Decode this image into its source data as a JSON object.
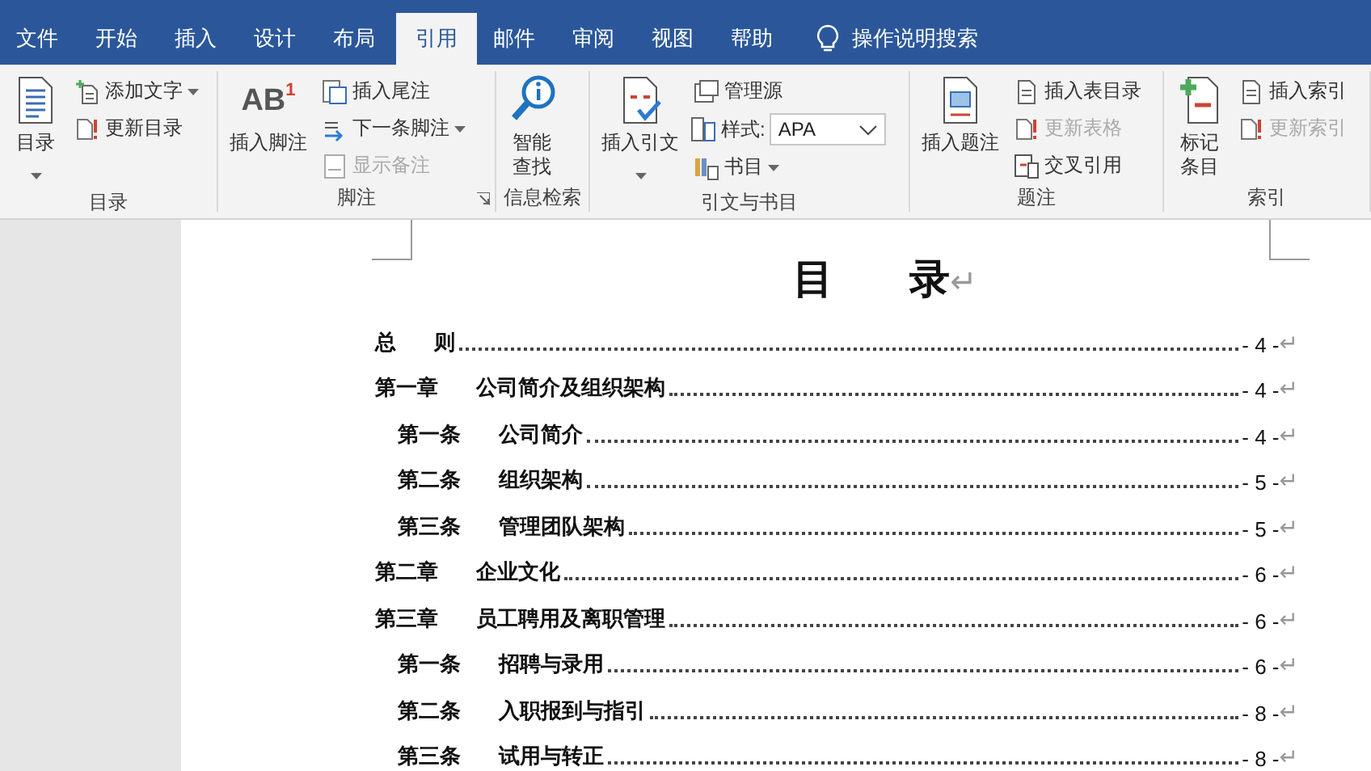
{
  "tabs": [
    {
      "label": "文件",
      "selected": false
    },
    {
      "label": "开始",
      "selected": false
    },
    {
      "label": "插入",
      "selected": false
    },
    {
      "label": "设计",
      "selected": false
    },
    {
      "label": "布局",
      "selected": false
    },
    {
      "label": "引用",
      "selected": true
    },
    {
      "label": "邮件",
      "selected": false
    },
    {
      "label": "审阅",
      "selected": false
    },
    {
      "label": "视图",
      "selected": false
    },
    {
      "label": "帮助",
      "selected": false
    }
  ],
  "tell_me": {
    "placeholder": "操作说明搜索"
  },
  "ribbon_groups": [
    {
      "label": "目录",
      "launcher": false,
      "big": [
        {
          "label": "目录",
          "dropdown": true
        }
      ],
      "small": [
        {
          "kind": "button",
          "label": "添加文字",
          "dropdown": true,
          "disabled": false
        },
        {
          "kind": "button",
          "label": "更新目录",
          "dropdown": false,
          "disabled": false
        }
      ]
    },
    {
      "label": "脚注",
      "launcher": true,
      "big": [
        {
          "label": "插入脚注",
          "glyph": "AB",
          "glyph_sup": "1",
          "dropdown": false
        }
      ],
      "small": [
        {
          "kind": "button",
          "label": "插入尾注",
          "dropdown": false,
          "disabled": false
        },
        {
          "kind": "button",
          "label": "下一条脚注",
          "dropdown": true,
          "disabled": false
        },
        {
          "kind": "button",
          "label": "显示备注",
          "dropdown": false,
          "disabled": true
        }
      ]
    },
    {
      "label": "信息检索",
      "launcher": false,
      "big": [
        {
          "label": "智能查找",
          "dropdown": false
        }
      ]
    },
    {
      "label": "引文与书目",
      "launcher": false,
      "big": [
        {
          "label": "插入引文",
          "dropdown": true
        }
      ],
      "small": [
        {
          "kind": "button",
          "label": "管理源",
          "dropdown": false,
          "disabled": false
        },
        {
          "kind": "select",
          "label": "样式:",
          "value": "APA"
        },
        {
          "kind": "button",
          "label": "书目",
          "dropdown": true,
          "disabled": false
        }
      ]
    },
    {
      "label": "题注",
      "launcher": false,
      "big": [
        {
          "label": "插入题注",
          "dropdown": false
        }
      ],
      "small": [
        {
          "kind": "button",
          "label": "插入表目录",
          "dropdown": false,
          "disabled": false
        },
        {
          "kind": "button",
          "label": "更新表格",
          "dropdown": false,
          "disabled": true
        },
        {
          "kind": "button",
          "label": "交叉引用",
          "dropdown": false,
          "disabled": false
        }
      ]
    },
    {
      "label": "索引",
      "launcher": false,
      "big": [
        {
          "label": "标记条目",
          "dropdown": false
        }
      ],
      "small": [
        {
          "kind": "button",
          "label": "插入索引",
          "dropdown": false,
          "disabled": false
        },
        {
          "kind": "button",
          "label": "更新索引",
          "dropdown": false,
          "disabled": true
        }
      ]
    }
  ],
  "document": {
    "title": "目 录",
    "title_mark": "↵",
    "toc": [
      {
        "title": "总 则",
        "page": "- 4 -",
        "end_mark": "↵"
      },
      {
        "number": "第一章",
        "title": "公司简介及组织架构",
        "page": "- 4 -",
        "end_mark": "↵",
        "children": [
          {
            "number": "第一条",
            "title": "公司简介",
            "page": "- 4 -",
            "end_mark": "↵"
          },
          {
            "number": "第二条",
            "title": "组织架构",
            "page": "- 5 -",
            "end_mark": "↵"
          },
          {
            "number": "第三条",
            "title": "管理团队架构",
            "page": "- 5 -",
            "end_mark": "↵"
          }
        ]
      },
      {
        "number": "第二章",
        "title": "企业文化",
        "page": "- 6 -",
        "end_mark": "↵"
      },
      {
        "number": "第三章",
        "title": "员工聘用及离职管理",
        "page": "- 6 -",
        "end_mark": "↵",
        "children": [
          {
            "number": "第一条",
            "title": "招聘与录用",
            "page": "- 6 -",
            "end_mark": "↵"
          },
          {
            "number": "第二条",
            "title": "入职报到与指引",
            "page": "- 8 -",
            "end_mark": "↵"
          },
          {
            "number": "第三条",
            "title": "试用与转正",
            "page": "- 8 -",
            "end_mark": "↵"
          }
        ]
      }
    ]
  }
}
